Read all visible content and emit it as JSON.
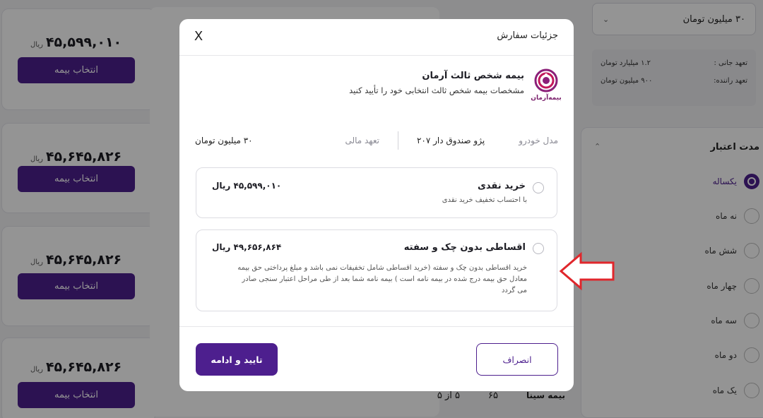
{
  "background": {
    "offers": [
      {
        "price": "۴۵,۵۹۹,۰۱۰",
        "currency": "ریال",
        "button": "انتخاب بیمه"
      },
      {
        "price": "۴۵,۶۴۵,۸۲۶",
        "currency": "ریال",
        "button": "انتخاب بیمه"
      },
      {
        "price": "۴۵,۶۴۵,۸۲۶",
        "currency": "ریال",
        "button": "انتخاب بیمه"
      },
      {
        "price": "۴۵,۶۴۵,۸۲۶",
        "currency": "ریال",
        "button": "انتخاب بیمه"
      }
    ],
    "bottom_row": {
      "insurer": "بیمه سینا",
      "score": "۶۵",
      "rating": "۵ از ۵"
    },
    "coverage_select": {
      "value": "۳۰ میلیون تومان"
    },
    "coverage_details": [
      {
        "label": "تعهد جانی :",
        "value": "۱.۲ میلیارد تومان"
      },
      {
        "label": "تعهد راننده:",
        "value": "۹۰۰ میلیون تومان"
      }
    ],
    "validity": {
      "title": "مدت اعتبار",
      "options": [
        {
          "label": "یکساله",
          "selected": true
        },
        {
          "label": "نه ماه",
          "selected": false
        },
        {
          "label": "شش ماه",
          "selected": false
        },
        {
          "label": "چهار ماه",
          "selected": false
        },
        {
          "label": "سه ماه",
          "selected": false
        },
        {
          "label": "دو ماه",
          "selected": false
        },
        {
          "label": "یک ماه",
          "selected": false
        }
      ]
    }
  },
  "modal": {
    "title": "جزئیات سفارش",
    "close": "X",
    "product": {
      "name": "بیمه شخص ثالث آرمان",
      "description": "مشخصات بیمه شخص ثالث انتخابی خود را تأیید کنید",
      "logo_caption": "بیمه‌آرمان"
    },
    "specs": {
      "car_label": "مدل خودرو",
      "car_value": "پژو صندوق دار ۲۰۷",
      "coverage_label": "تعهد مالی",
      "coverage_value": "۳۰ میلیون تومان"
    },
    "payment_options": [
      {
        "title": "خرید نقدی",
        "subtitle": "با احتساب تخفیف خرید نقدی",
        "amount": "۴۵,۵۹۹,۰۱۰ ریال",
        "selected": false
      },
      {
        "title": "اقساطی بدون چک و سفته",
        "description": "خرید اقساطی بدون چک و سفته (خرید اقساطی شامل تخفیفات نمی باشد و مبلغ پرداختی حق بیمه معادل حق بیمه درج شده در بیمه نامه است ) بیمه نامه شما بعد از طی مراحل اعتبار سنجی صادر می گردد",
        "amount": "۴۹,۶۵۶,۸۶۴ ریال",
        "selected": false
      }
    ],
    "buttons": {
      "confirm": "تایید و ادامه",
      "cancel": "انصراف"
    }
  },
  "colors": {
    "brand": "#4d1f8e",
    "annotation": "#e0262b"
  }
}
